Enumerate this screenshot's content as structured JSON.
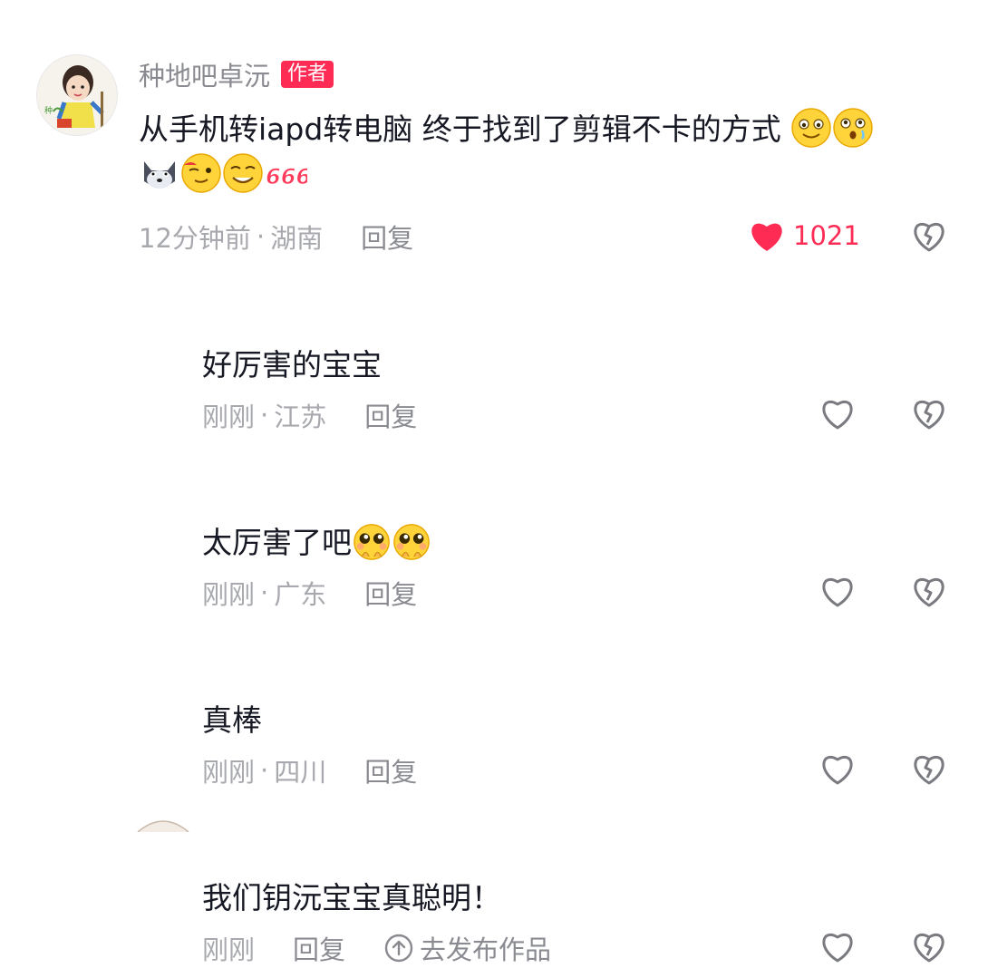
{
  "main_comment": {
    "author": "种地吧卓沅",
    "badge": "作者",
    "text": "从手机转iapd转电脑 终于找到了剪辑不卡的方式",
    "sticker_666": "666",
    "time": "12分钟前",
    "location": "湖南",
    "reply_label": "回复",
    "like_count": "1021",
    "liked": true
  },
  "replies": [
    {
      "text": "好厉害的宝宝",
      "time": "刚刚",
      "location": "江苏",
      "reply_label": "回复"
    },
    {
      "text": "太厉害了吧",
      "time": "刚刚",
      "location": "广东",
      "reply_label": "回复"
    },
    {
      "text": "真棒",
      "time": "刚刚",
      "location": "四川",
      "reply_label": "回复"
    },
    {
      "text": "我们钥沅宝宝真聪明！",
      "time": "刚刚",
      "reply_label": "回复",
      "publish_label": "去发布作品"
    }
  ],
  "separator": "·",
  "colors": {
    "accent": "#fe2c55",
    "meta": "#a8a9ae",
    "text": "#161823"
  },
  "icons": [
    "heart-filled-icon",
    "heart-outline-icon",
    "broken-heart-icon",
    "upload-circle-icon",
    "emoji-icon"
  ]
}
